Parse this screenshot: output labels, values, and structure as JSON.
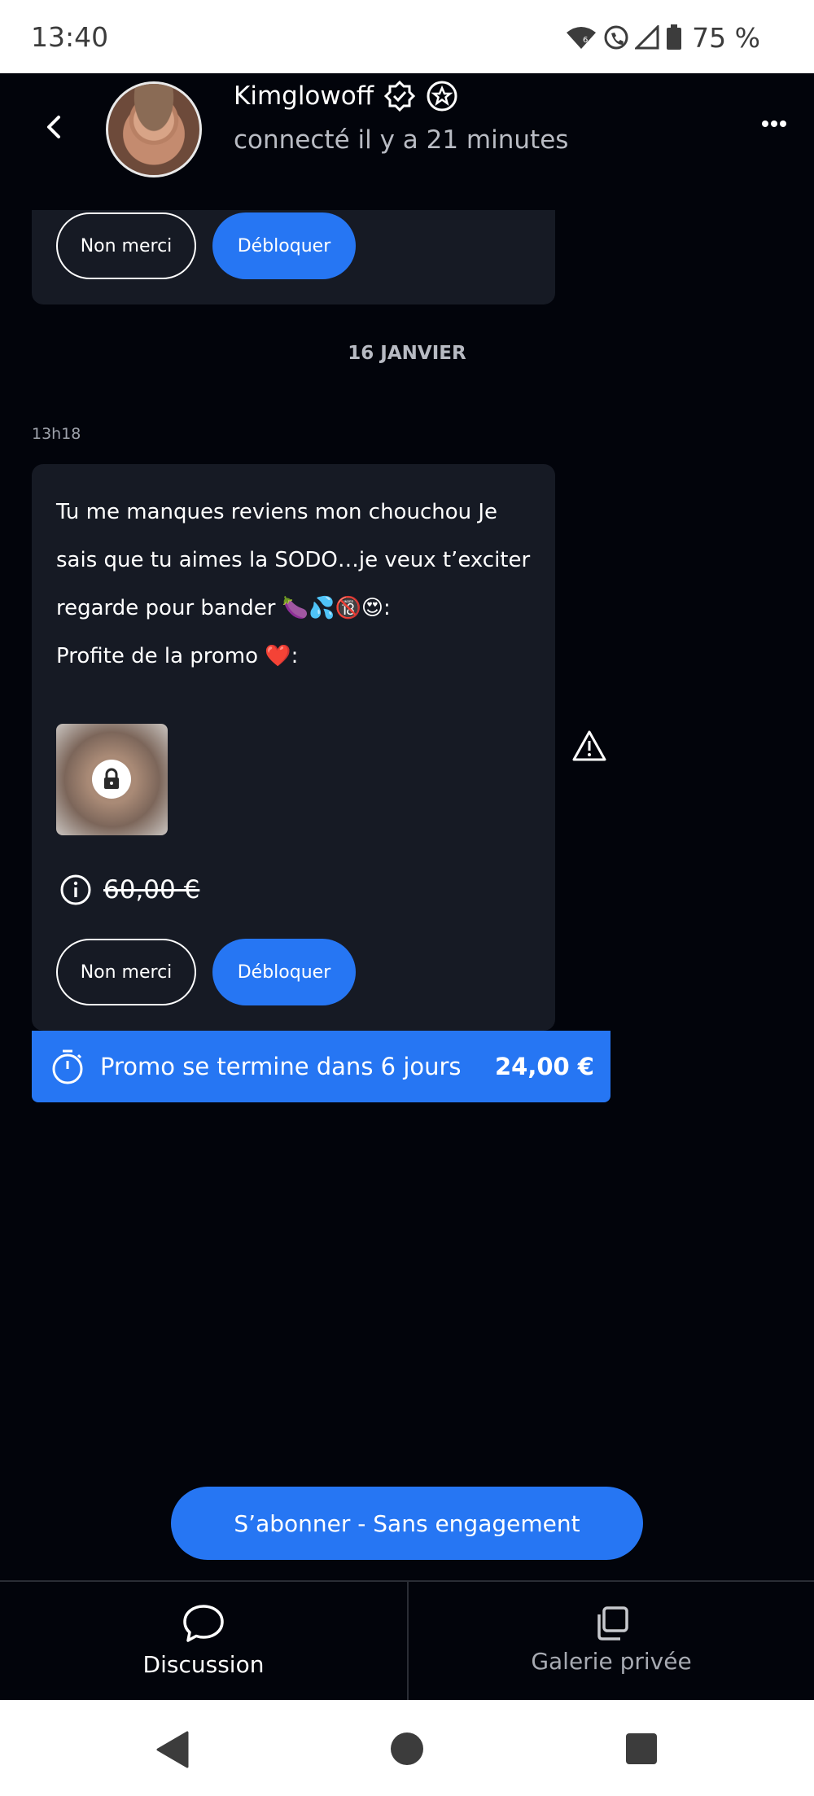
{
  "status_bar": {
    "time": "13:40",
    "battery": "75 %"
  },
  "header": {
    "name": "Kimglowoff",
    "subtitle": "connecté il y a 21 minutes"
  },
  "previous_offer": {
    "decline_label": "Non merci",
    "unlock_label": "Débloquer"
  },
  "date_separator": "16 JANVIER",
  "message": {
    "time": "13h18",
    "line1": "Tu me manques reviens mon chouchou Je",
    "line2": "sais que tu aimes la SODO…je veux t’exciter",
    "line3_text": "regarde pour bander",
    "line3_emojis": "🍆💦🔞😍",
    "line3_end": ":",
    "line4_text": "Profite de la promo",
    "line4_emoji": "❤️",
    "line4_end": ":",
    "original_price": "60,00 €",
    "decline_label": "Non merci",
    "unlock_label": "Débloquer"
  },
  "promo": {
    "label": "Promo se termine dans 6 jours",
    "price": "24,00 €"
  },
  "subscribe_label": "S’abonner - Sans engagement",
  "tabs": [
    {
      "label": "Discussion",
      "icon": "chat-bubble-icon",
      "active": true
    },
    {
      "label": "Galerie privée",
      "icon": "gallery-copy-icon",
      "active": false
    }
  ],
  "colors": {
    "accent": "#2676f3",
    "background": "#02040b",
    "bubble": "#161a24"
  }
}
